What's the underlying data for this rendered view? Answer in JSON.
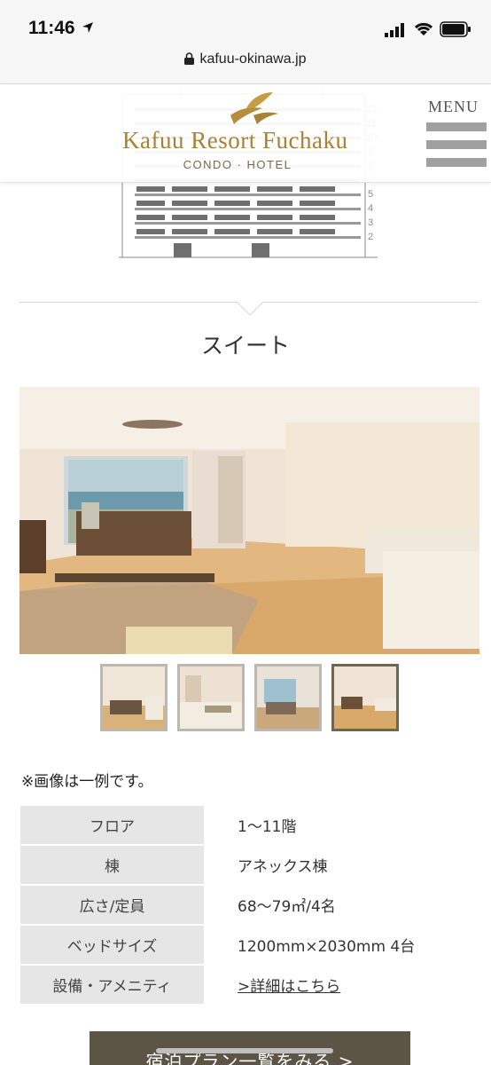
{
  "status_bar": {
    "time": "11:46",
    "url": "kafuu-okinawa.jp"
  },
  "header": {
    "logo_name": "Kafuu Resort Fuchaku",
    "logo_sub": "CONDO · HOTEL",
    "menu_label": "MENU"
  },
  "section": {
    "title": "スイート"
  },
  "gallery": {
    "thumb_count": 4,
    "active_index": 3
  },
  "note": "※画像は一例です。",
  "specs": [
    {
      "label": "フロア",
      "value": "1〜11階"
    },
    {
      "label": "棟",
      "value": "アネックス棟"
    },
    {
      "label": "広さ/定員",
      "value": "68〜79㎡/4名"
    },
    {
      "label": "ベッドサイズ",
      "value": "1200mm×2030mm 4台"
    },
    {
      "label": "設備・アメニティ",
      "value": ">詳細はこちら"
    }
  ],
  "plan_button": "宿泊プラン一覧をみる >",
  "colors": {
    "gold": "#a88234",
    "button": "#5c5445",
    "table_header": "#e6e6e6"
  }
}
